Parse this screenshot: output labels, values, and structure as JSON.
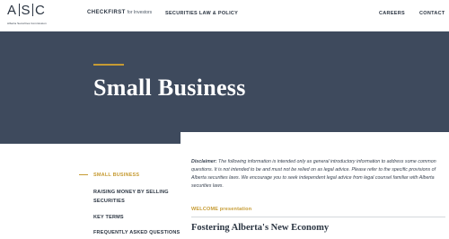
{
  "header": {
    "logo": {
      "letters": [
        "A",
        "S",
        "C"
      ],
      "subtitle": "Alberta Securities Commission"
    },
    "nav": {
      "checkfirst_brand": "CHECKFIRST",
      "checkfirst_sub": "for Investors",
      "securities_law": "SECURITIES LAW & POLICY",
      "careers": "CAREERS",
      "contact": "CONTACT"
    }
  },
  "hero": {
    "title": "Small Business"
  },
  "sidebar": {
    "items": [
      {
        "label": "SMALL BUSINESS",
        "active": true
      },
      {
        "label_line1": "RAISING MONEY BY SELLING",
        "label_line2": "SECURITIES",
        "active": false
      },
      {
        "label": "KEY TERMS",
        "active": false
      },
      {
        "label": "FREQUENTLY ASKED QUESTIONS",
        "active": false
      }
    ]
  },
  "main": {
    "disclaimer_label": "Disclaimer:",
    "disclaimer_text": "The following information is intended only as general introductory information to address some common questions. It is not intended to be and must not be relied on as legal advice. Please refer to the specific provisions of Alberta securities laws. We encourage you to seek independent legal advice from legal counsel familiar with Alberta securities laws.",
    "welcome_label": "WELCOME presentation",
    "section_heading": "Fostering Alberta's New Economy"
  },
  "colors": {
    "navy": "#3e4a5d",
    "gold": "#c69b33",
    "text": "#2b3542"
  }
}
